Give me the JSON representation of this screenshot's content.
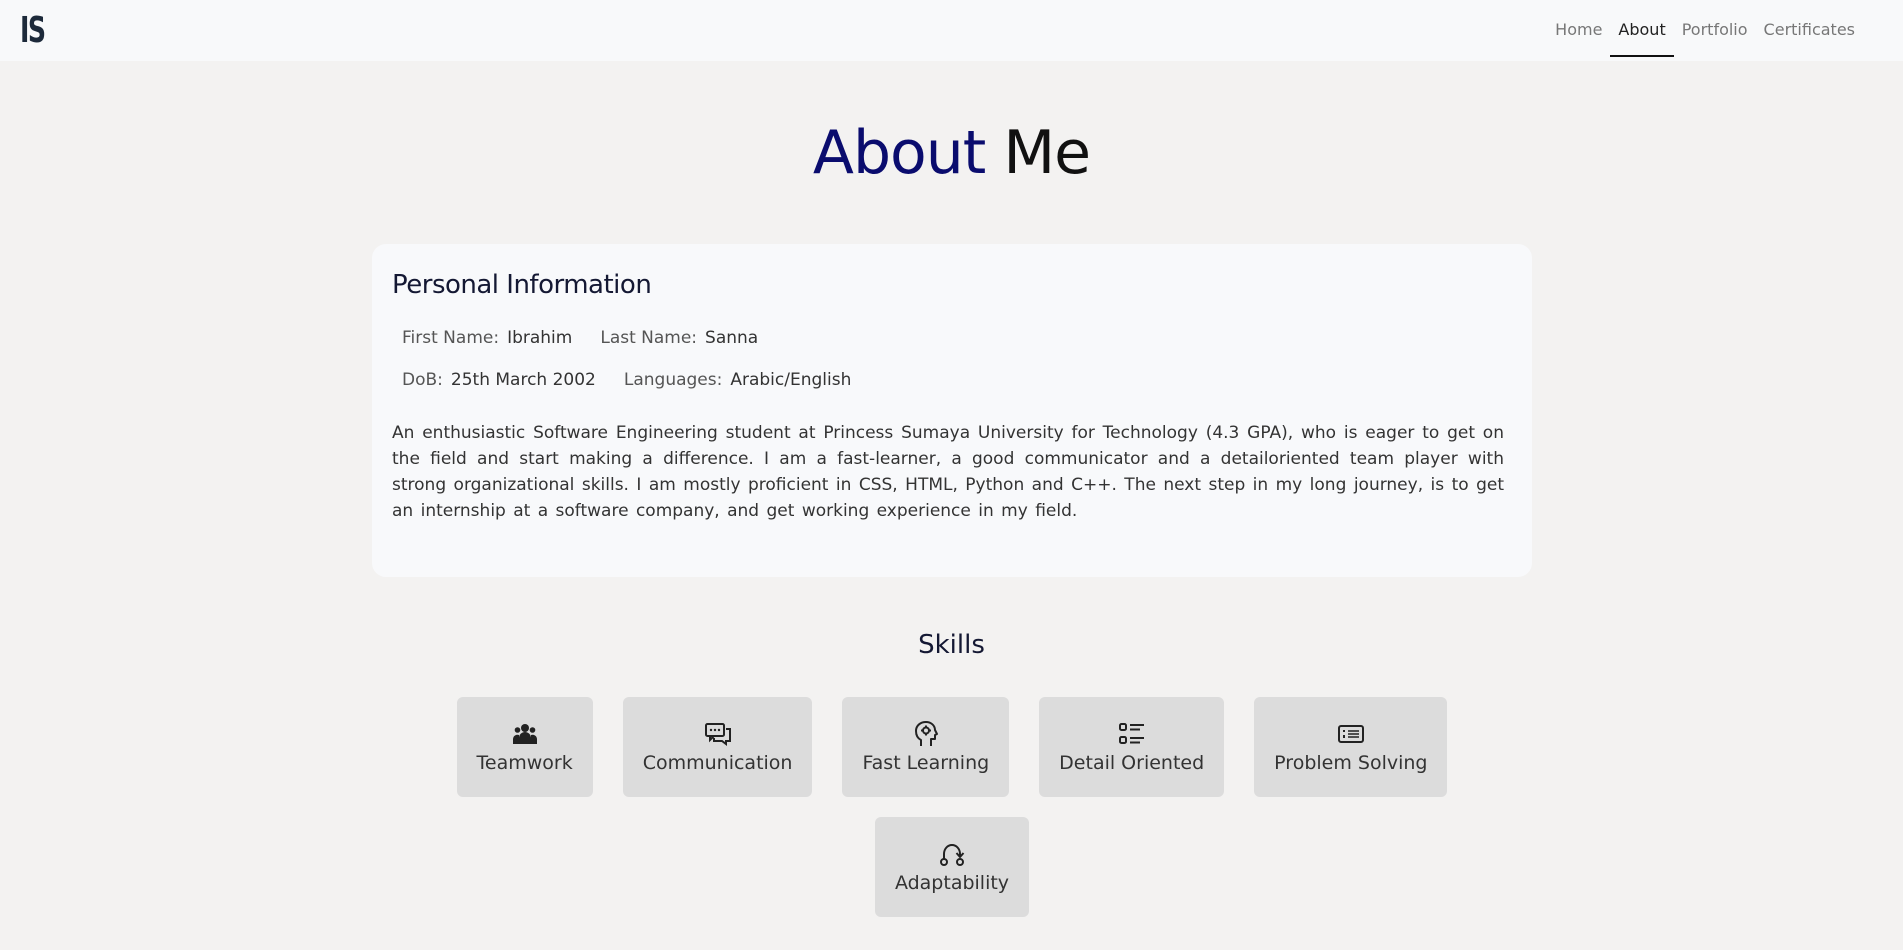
{
  "navbar": {
    "logo": "IS",
    "links": [
      {
        "label": "Home",
        "active": false
      },
      {
        "label": "About",
        "active": true
      },
      {
        "label": "Portfolio",
        "active": false
      },
      {
        "label": "Certificates",
        "active": false
      }
    ]
  },
  "page": {
    "title_part1": "About",
    "title_part2": " Me"
  },
  "personal_info": {
    "heading": "Personal Information",
    "first_name_label": "First Name:",
    "first_name_value": "Ibrahim",
    "last_name_label": "Last Name:",
    "last_name_value": "Sanna",
    "dob_label": "DoB:",
    "dob_value": "25th March 2002",
    "languages_label": "Languages:",
    "languages_value": "Arabic/English",
    "bio": "An enthusiastic Software Engineering student at Princess Sumaya University for Technology (4.3 GPA), who is eager to get on the field and start making a difference. I am a fast-learner, a good communicator and a detailoriented team player with strong organizational skills. I am mostly proficient in CSS, HTML, Python and C++. The next step in my long journey, is to get an internship at a software company, and get working experience in my field."
  },
  "skills": {
    "heading": "Skills",
    "items": [
      {
        "label": "Teamwork",
        "icon": "people-icon"
      },
      {
        "label": "Communication",
        "icon": "chat-icon"
      },
      {
        "label": "Fast Learning",
        "icon": "head-gear-icon"
      },
      {
        "label": "Detail Oriented",
        "icon": "list-icon"
      },
      {
        "label": "Problem Solving",
        "icon": "card-list-icon"
      },
      {
        "label": "Adaptability",
        "icon": "route-icon"
      }
    ]
  },
  "colors": {
    "title_accent": "#0a0c6e",
    "page_bg": "#f3f2f1",
    "card_bg": "#f8f9fb",
    "skill_bg": "#dcdcdc"
  }
}
